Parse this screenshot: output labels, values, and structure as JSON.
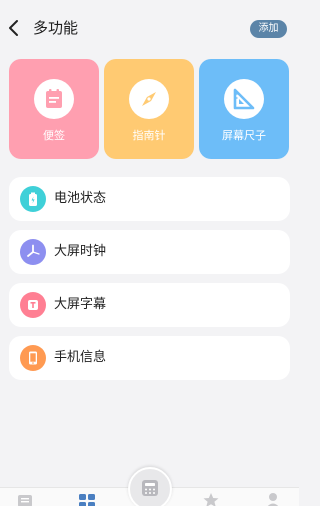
{
  "header": {
    "title": "多功能",
    "add_label": "添加",
    "back_icon": "chevron-left-icon"
  },
  "tiles": [
    {
      "label": "便签",
      "icon": "notepad-icon",
      "color": "#ff9fb0"
    },
    {
      "label": "指南针",
      "icon": "compass-icon",
      "color": "#ffca72"
    },
    {
      "label": "屏幕尺子",
      "icon": "ruler-icon",
      "color": "#6dbdf8"
    }
  ],
  "items": [
    {
      "label": "电池状态",
      "icon": "battery-icon",
      "color": "#3fd0d8"
    },
    {
      "label": "大屏时钟",
      "icon": "clock-icon",
      "color": "#8d8ff0"
    },
    {
      "label": "大屏字幕",
      "icon": "subtitle-icon",
      "color": "#ff7f93"
    },
    {
      "label": "手机信息",
      "icon": "phone-icon",
      "color": "#ff9a52"
    }
  ],
  "bottom_nav": {
    "items": [
      {
        "icon": "list-icon"
      },
      {
        "icon": "grid-icon",
        "active": true
      },
      {
        "icon": "calculator-icon"
      },
      {
        "icon": "star-icon"
      },
      {
        "icon": "person-icon"
      }
    ]
  }
}
